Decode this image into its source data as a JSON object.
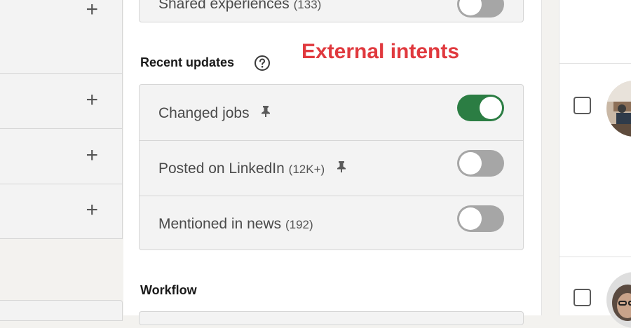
{
  "left_panel": {
    "add_icon": "plus-icon"
  },
  "shared_experiences": {
    "label": "Shared experiences",
    "count": "(133)",
    "enabled": false
  },
  "recent_updates": {
    "heading": "Recent updates",
    "help_icon": "question-circle-icon",
    "rows": [
      {
        "label": "Changed jobs",
        "count": "",
        "pinned": true,
        "enabled": true
      },
      {
        "label": "Posted on LinkedIn",
        "count": "(12K+)",
        "pinned": true,
        "enabled": false
      },
      {
        "label": "Mentioned in news",
        "count": "(192)",
        "pinned": false,
        "enabled": false
      }
    ]
  },
  "annotation": {
    "text": "External intents",
    "color": "#e0393e"
  },
  "workflow": {
    "heading": "Workflow"
  },
  "colors": {
    "toggle_on": "#2b7d43",
    "toggle_off": "#a6a6a6",
    "panel_bg": "#f3f3f3"
  }
}
